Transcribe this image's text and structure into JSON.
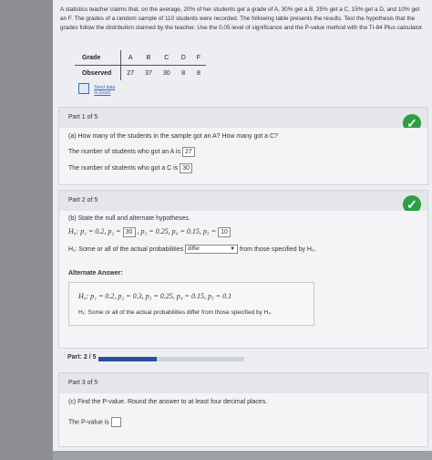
{
  "problem": {
    "text": "A statistics teacher claims that, on the average, 20% of her students get a grade of A, 30% get a B, 25% get a C, 15% get a D, and 10% get an F. The grades of a random sample of 110 students were recorded. The following table presents the results. Test the hypothesis that the grades follow the distribution claimed by the teacher. Use the 0.05 level of significance and the P-value method with the TI-84 Plus calculator."
  },
  "table": {
    "header_label": "Grade",
    "row_label": "Observed",
    "grades": [
      "A",
      "B",
      "C",
      "D",
      "F"
    ],
    "observed": [
      "27",
      "37",
      "30",
      "8",
      "8"
    ]
  },
  "send_data": {
    "line1": "Send data",
    "line2": "to Excel"
  },
  "part1": {
    "label": "Part 1 of 5",
    "question": "(a) How many of the students in the sample got an A? How many got a C?",
    "a_text": "The number of students who got an A is",
    "a_value": "27",
    "c_text": "The number of students who got a C is",
    "c_value": "30"
  },
  "part2": {
    "label": "Part 2 of 5",
    "question": "(b) State the null and alternate hypotheses.",
    "h0_prefix": "H₀: p₁ = 0.2, p₂ =",
    "p2_value": "30",
    "h0_mid": ", p₃ = 0.25, p₄ = 0.15, p₅ =",
    "p5_value": "10",
    "h1_prefix": "H₁: Some or all of the actual probabilities",
    "h1_select": "differ",
    "h1_suffix": "from those specified by H₀."
  },
  "alternate": {
    "title": "Alternate Answer:",
    "h0": "H₀: p₁ = 0.2, p₂ = 0.3, p₃ = 0.25, p₄ = 0.15, p₅ = 0.1",
    "h1": "H₁: Some or all of the actual probabilities differ from those specified by H₀."
  },
  "progress": {
    "label": "Part: 2 / 5",
    "fraction": 0.4
  },
  "part3": {
    "label": "Part 3 of 5",
    "question": "(c) Find the P-value. Round the answer to at least four decimal places.",
    "pvalue_text": "The P-value is"
  },
  "colors": {
    "check_green": "#2f9e44",
    "progress_blue": "#2a4d9e"
  }
}
